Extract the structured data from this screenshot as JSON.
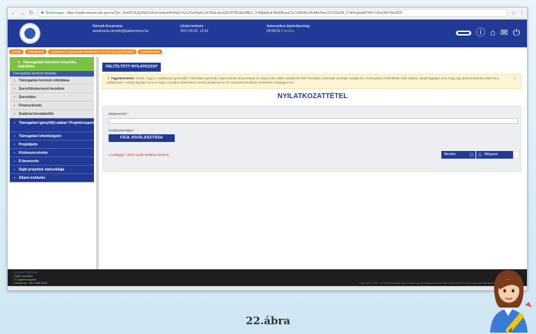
{
  "browser": {
    "secure_label": "Biztonságos",
    "url": "https://epitk-release.fair.gov.hu/?p=_fl=eEFSUjQ3hEOUIUehxAzre9hWqInTu1uTImHq0k7uFX8uLwhuQFe2PSDdeSIBEZ_fl-Mj9pkEdrS8eKBepsCzCURKBmJ0v8Ak2hxLOCOSeD8_C-MHcgbqWFWhTxDw2Nh7Hs2020"
  },
  "header": {
    "user_name": "Németh Annamária",
    "user_email": "annamaria.nemeth@ipaltermnew.hu",
    "last_login_label": "Utolsó belépés:",
    "last_login_value": "2017.05.25. 12:41",
    "auto_logout_label": "Automatikus kijelentkezésig:",
    "auto_logout_value": "00:58:53",
    "auto_logout_status": "Frissítés"
  },
  "breadcrumb": [
    "Kezdő",
    "Folyamatok",
    "Megjelenet Kapcsolódó kérelmekre és bírósági kérvényekre",
    "Nyilatkozatok"
  ],
  "sidebar": {
    "active": "Támogatási kérelem készítés, beküldés",
    "active_sub": "Támogatási kérelem beadás",
    "grey_items": [
      "Támogatási kérelem elbírálása",
      "Szerződéstervezet kezelése",
      "Szerződés",
      "Finanszírozás",
      "Szakmai beszámolók"
    ],
    "blue_items": [
      "Támogatási igénylő(k) adatai / Projektcsoport",
      "Támogatási lehetőségeim",
      "Projektjeim",
      "Közbeszerzéseim",
      "E-beszerzés",
      "Saját projektek statisztikája",
      "Állami értékelés"
    ]
  },
  "main": {
    "tab_label": "FELTÖLTÖTT NYILATKOZAT",
    "notice_label": "Figyelmeztetés:",
    "notice_text": "Kérjük, hogy a „Nyilatkozat generálás\" funkcióban generált, majd letöltött, kinyomtatott és cégszerűen aláírt nyilatkozat PDF formában szkennelt verzióját csatolja fel. Amennyiben a feltöltésbe több oldalas, kérjük figyeljen arra, hogy egy dokumentumba töltse fel a nyilatkozatot. Kérjük figyeljen arra is, hogy a portálon bekezdésre került nyilatkozat az itt csatolásra kerülővel mindenben megegyezzen.",
    "title": "NYILATKOZATTÉTEL",
    "name_label": "Megnevezés",
    "file_label": "Kiválasztott fájlok",
    "file_button": "FÁJL KIVÁLASZTÁSA",
    "required_note": "A csillaggal * jelölt mezők kitöltése kötelező.",
    "save_button": "Mentés",
    "cancel_button": "Mégsem"
  },
  "footer": {
    "heading": "ELÉRHETŐSÉGEK",
    "lines": [
      "Nyitó mezőkre",
      "E-ügyfélszolgálat",
      "Infovonal: +36 1 896 0000"
    ],
    "copyright": "Copyright © 2017 – Miniszterelnökség Irányító Hatósága és Magyar Államkincstár Fejlesztésért Felelős Fejlesztési Igazgatósága minden jog fenntartva."
  },
  "caption": "22.ábra",
  "colors": {
    "brand_blue": "#213a95",
    "accent_green": "#7bc144",
    "breadcrumb_orange": "#f08a1a",
    "required_red": "#d9261c"
  }
}
